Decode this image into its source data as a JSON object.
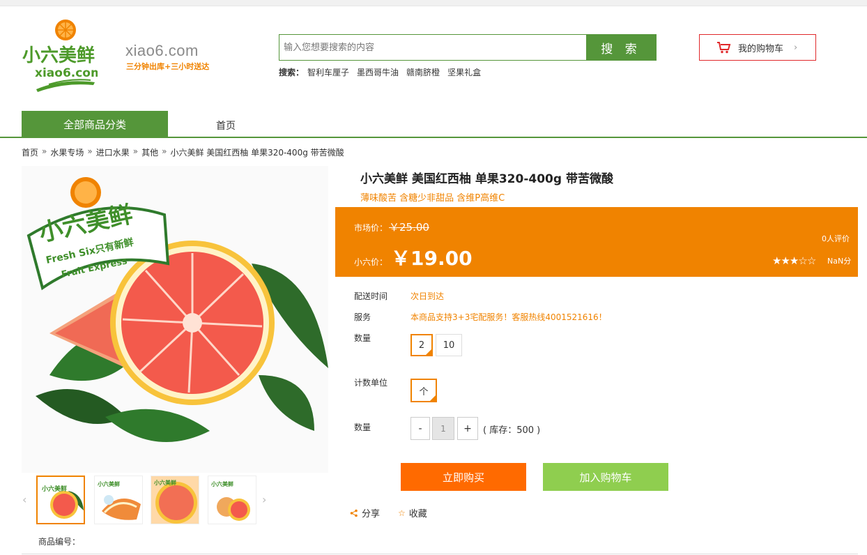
{
  "header": {
    "domain": "xiao6.com",
    "slogan": "三分钟出库+三小时送达",
    "logo_text": "小六美鲜 xiao6.com"
  },
  "search": {
    "placeholder": "输入您想要搜索的内容",
    "button_label": "搜 索",
    "hot_label": "搜索：",
    "hot_words": [
      "智利车厘子",
      "墨西哥牛油",
      "赣南脐橙",
      "坚果礼盒"
    ]
  },
  "cart": {
    "label": "我的购物车",
    "chevron": "›"
  },
  "nav": {
    "category_label": "全部商品分类",
    "home_label": "首页"
  },
  "breadcrumb": [
    "首页",
    "水果专场",
    "进口水果",
    "其他",
    "小六美鲜 美国红西柚 单果320-400g 带苦微酸"
  ],
  "breadcrumb_sep": "»",
  "gallery": {
    "thumb_count": 4,
    "active_index": 0,
    "prev": "‹",
    "next": "›"
  },
  "sku_label": "商品编号：",
  "product": {
    "title": "小六美鲜 美国红西柚 单果320-400g 带苦微酸",
    "subtitle": "薄味酸苦 含糖少非甜品 含维P高维C",
    "market_label": "市场价：",
    "market_price": "￥25.00",
    "our_label": "小六价：",
    "our_price": "￥19.00",
    "reviews": "0人评价",
    "rating": 3,
    "rating_max": 5,
    "score": "NaN分"
  },
  "details": {
    "delivery_label": "配送时间",
    "delivery_value": "次日到达",
    "service_label": "服务",
    "service_value": "本商品支持3+3宅配服务！客服热线4001521616！",
    "spec_label": "数量",
    "spec_options": [
      "2",
      "10"
    ],
    "unit_label": "计数单位",
    "unit_options": [
      "个"
    ],
    "qty_label": "数量",
    "qty_minus": "-",
    "qty_value": "1",
    "qty_plus": "+",
    "stock": "( 库存：500 )"
  },
  "actions": {
    "buy": "立即购买",
    "add_cart": "加入购物车",
    "share": "分享",
    "favorite": "收藏"
  },
  "colors": {
    "brand_green": "#55963a",
    "accent_orange": "#f08300",
    "buy_orange": "#ff6a00",
    "cart_green": "#8fce4f"
  }
}
